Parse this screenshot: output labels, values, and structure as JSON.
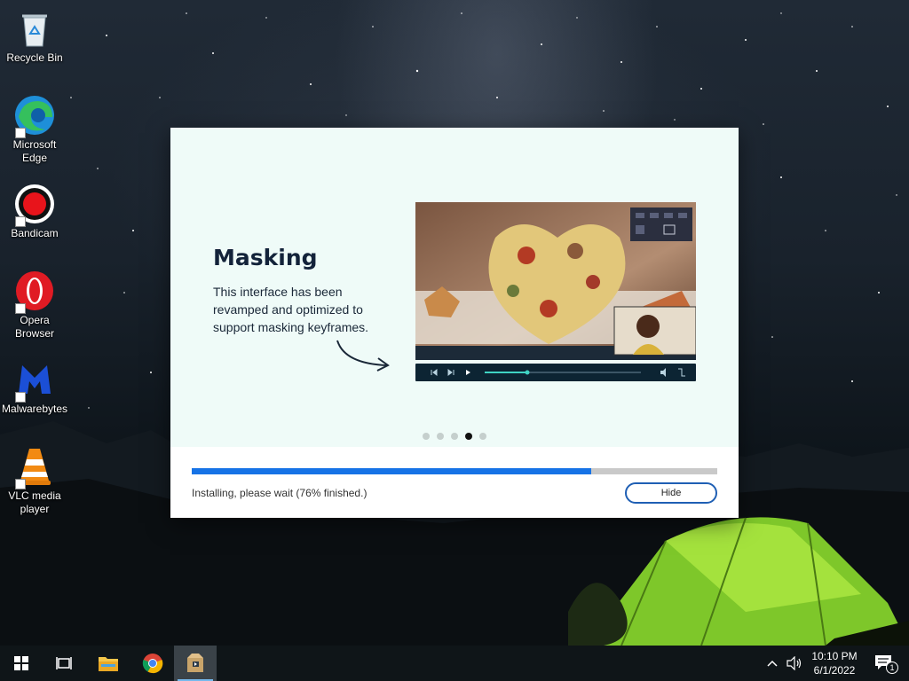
{
  "desktop": {
    "icons": [
      {
        "label": "Recycle Bin",
        "icon": "recycle-bin-icon"
      },
      {
        "label": "Microsoft Edge",
        "icon": "edge-icon"
      },
      {
        "label": "Bandicam",
        "icon": "bandicam-icon"
      },
      {
        "label": "Opera Browser",
        "icon": "opera-icon"
      },
      {
        "label": "Malwarebytes",
        "icon": "malwarebytes-icon"
      },
      {
        "label": "VLC media player",
        "icon": "vlc-icon"
      }
    ]
  },
  "installer": {
    "slide": {
      "title": "Masking",
      "description": "This interface has been revamped and optimized to support masking keyframes."
    },
    "carousel": {
      "count": 5,
      "active_index": 3
    },
    "progress": {
      "percent": 76,
      "status": "Installing, please wait (76% finished.)"
    },
    "hide_label": "Hide"
  },
  "taskbar": {
    "items": [
      "start-icon",
      "task-view-icon",
      "file-explorer-icon",
      "chrome-icon",
      "installer-app-icon"
    ],
    "clock": {
      "time": "10:10 PM",
      "date": "6/1/2022"
    },
    "notification_count": "1"
  },
  "colors": {
    "accent": "#1673e6",
    "dialog_bg": "#effbf8",
    "taskbar_bg": "#0f1518",
    "hide_border": "#1f5fb4"
  }
}
